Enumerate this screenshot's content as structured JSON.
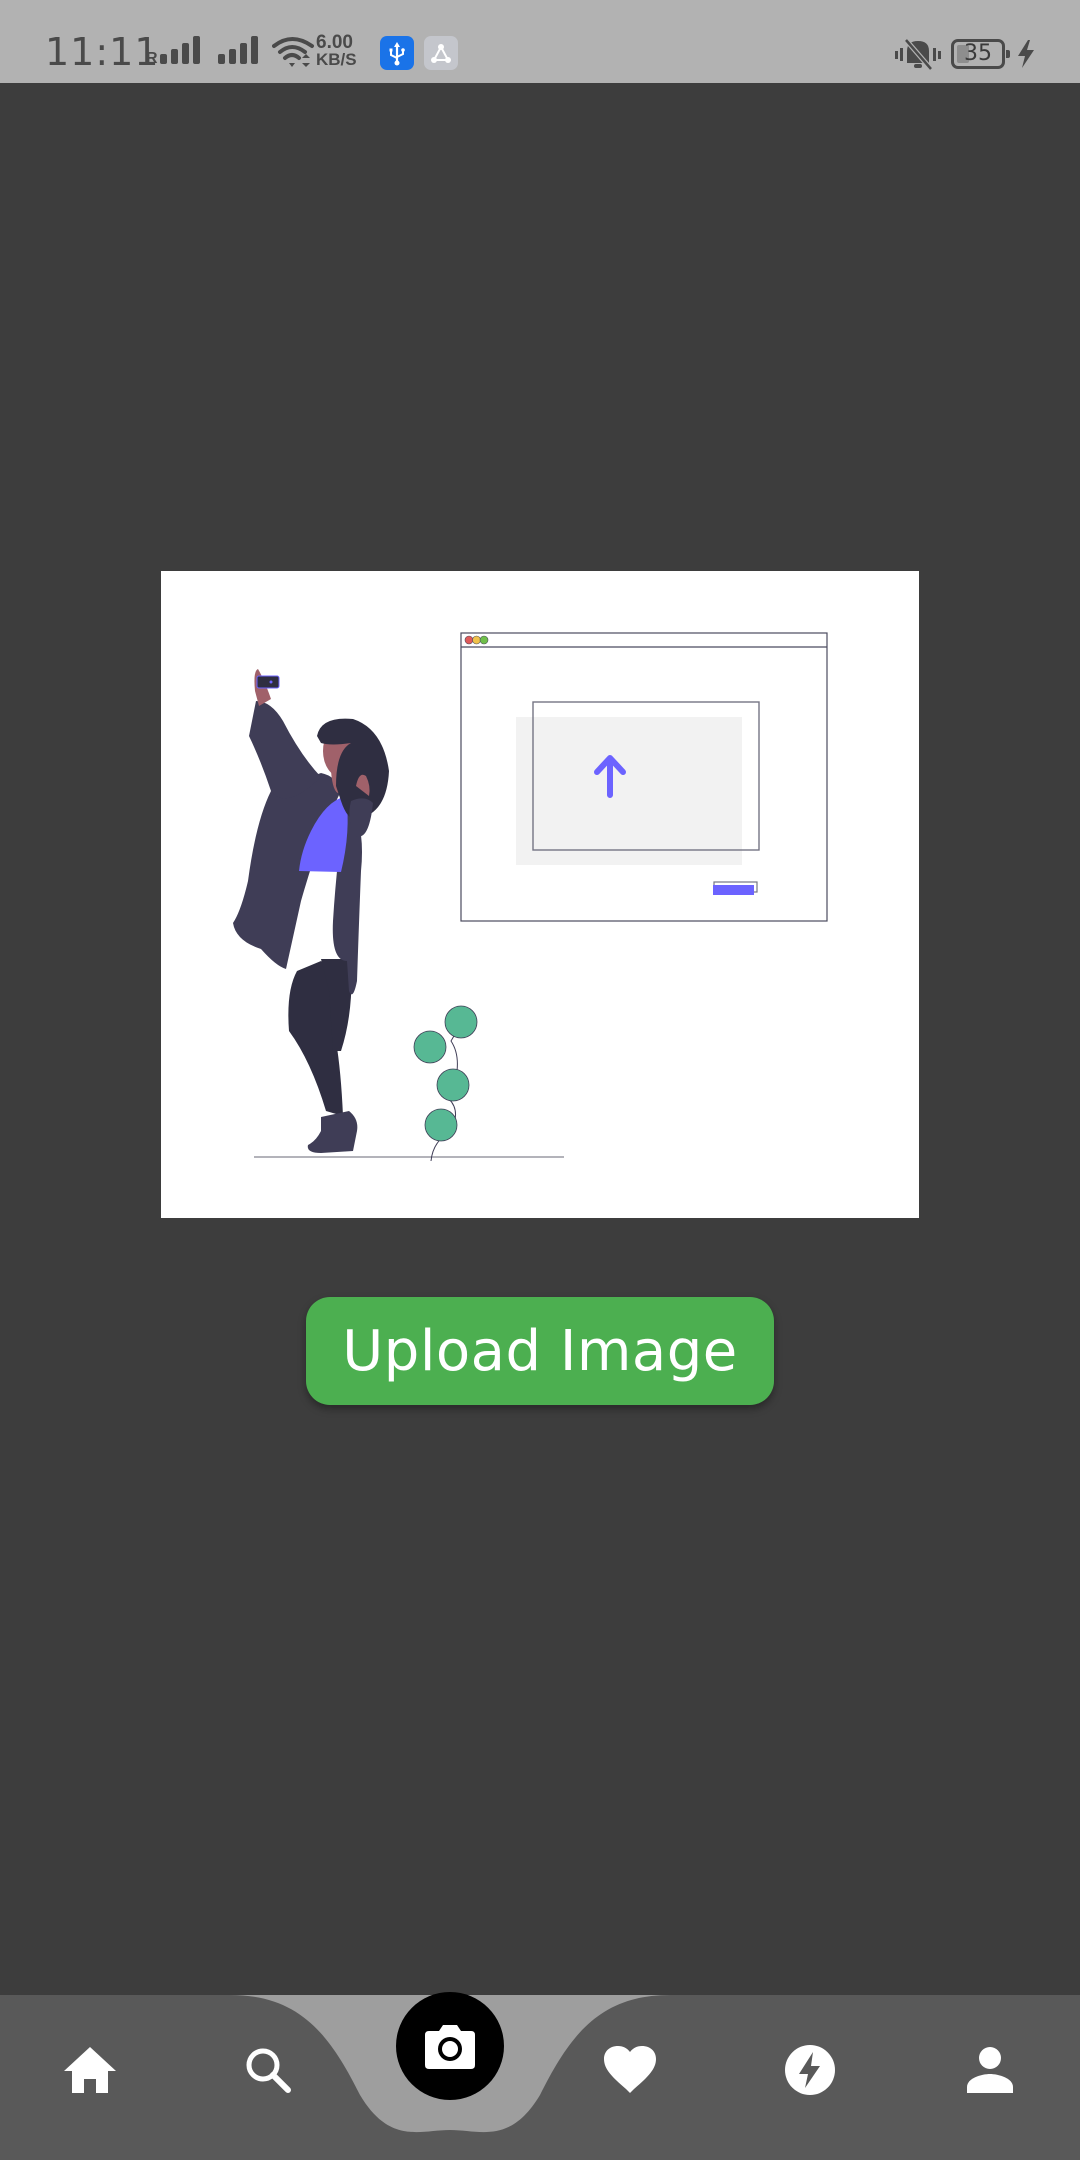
{
  "status_bar": {
    "time": "11:11",
    "roaming_indicator": "R",
    "network_speed_value": "6.00",
    "network_speed_unit": "KB/S",
    "battery_level": "35",
    "icons": [
      "signal-roaming-icon",
      "signal-icon",
      "wifi-icon",
      "usb-icon",
      "share-icon",
      "vibrate-mute-icon",
      "battery-icon",
      "charging-icon"
    ],
    "colors": {
      "background": "#b2b2b2",
      "usb_badge": "#1a73e8",
      "share_badge": "#c4c6cc"
    }
  },
  "main": {
    "illustration": {
      "description": "person taking selfie next to upload window illustration",
      "accent_color": "#6c63ff",
      "plant_color": "#57b894"
    },
    "upload_button": {
      "label": "Upload Image",
      "color": "#4caf50"
    }
  },
  "bottom_nav": {
    "items": [
      {
        "name": "home",
        "icon": "home-icon"
      },
      {
        "name": "search",
        "icon": "search-icon"
      },
      {
        "name": "camera",
        "icon": "camera-icon",
        "active": true
      },
      {
        "name": "favorites",
        "icon": "heart-icon"
      },
      {
        "name": "flash",
        "icon": "bolt-icon"
      },
      {
        "name": "profile",
        "icon": "person-icon"
      }
    ],
    "colors": {
      "bar": "#595959",
      "active_notch": "#9e9e9e",
      "active_circle": "#000000",
      "icon": "#ffffff"
    }
  },
  "colors": {
    "page_background": "#3d3d3d"
  }
}
